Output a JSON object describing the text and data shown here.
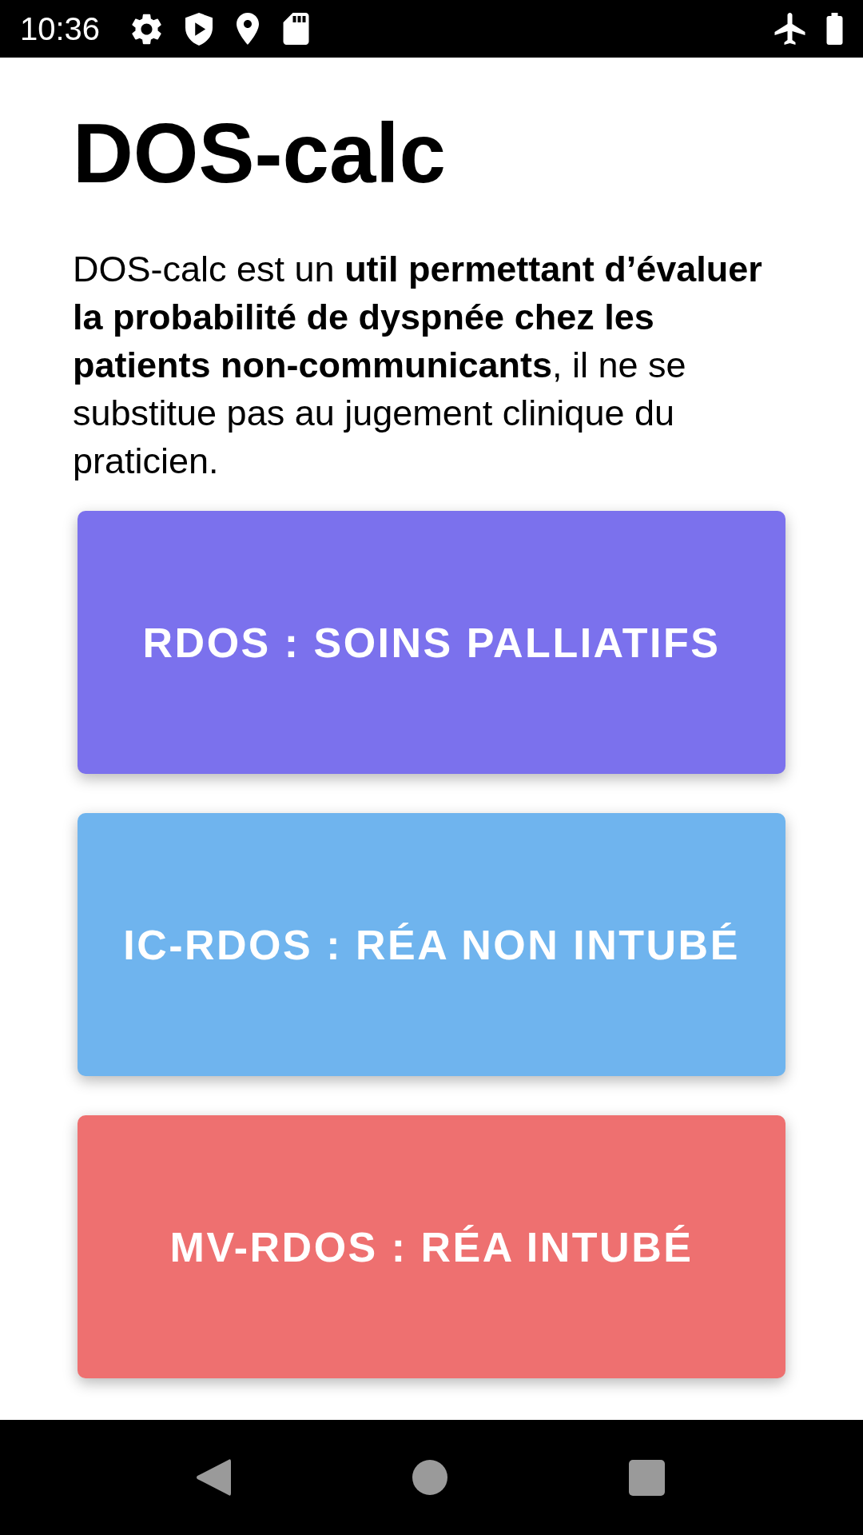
{
  "status_bar": {
    "time": "10:36"
  },
  "title": "DOS-calc",
  "description": "DOS-calc est un **util permettant d’évaluer la probabilité de dyspnée chez les patients non-communicants**, il ne se substitue pas au jugement clinique du praticien.",
  "buttons": [
    {
      "label": "RDOS : SOINS PALLIATIFS",
      "color": "#7b71ed"
    },
    {
      "label": "IC-RDOS : RÉA NON INTUBÉ",
      "color": "#6fb4ee"
    },
    {
      "label": "MV-RDOS : RÉA INTUBÉ",
      "color": "#ee7070"
    }
  ]
}
